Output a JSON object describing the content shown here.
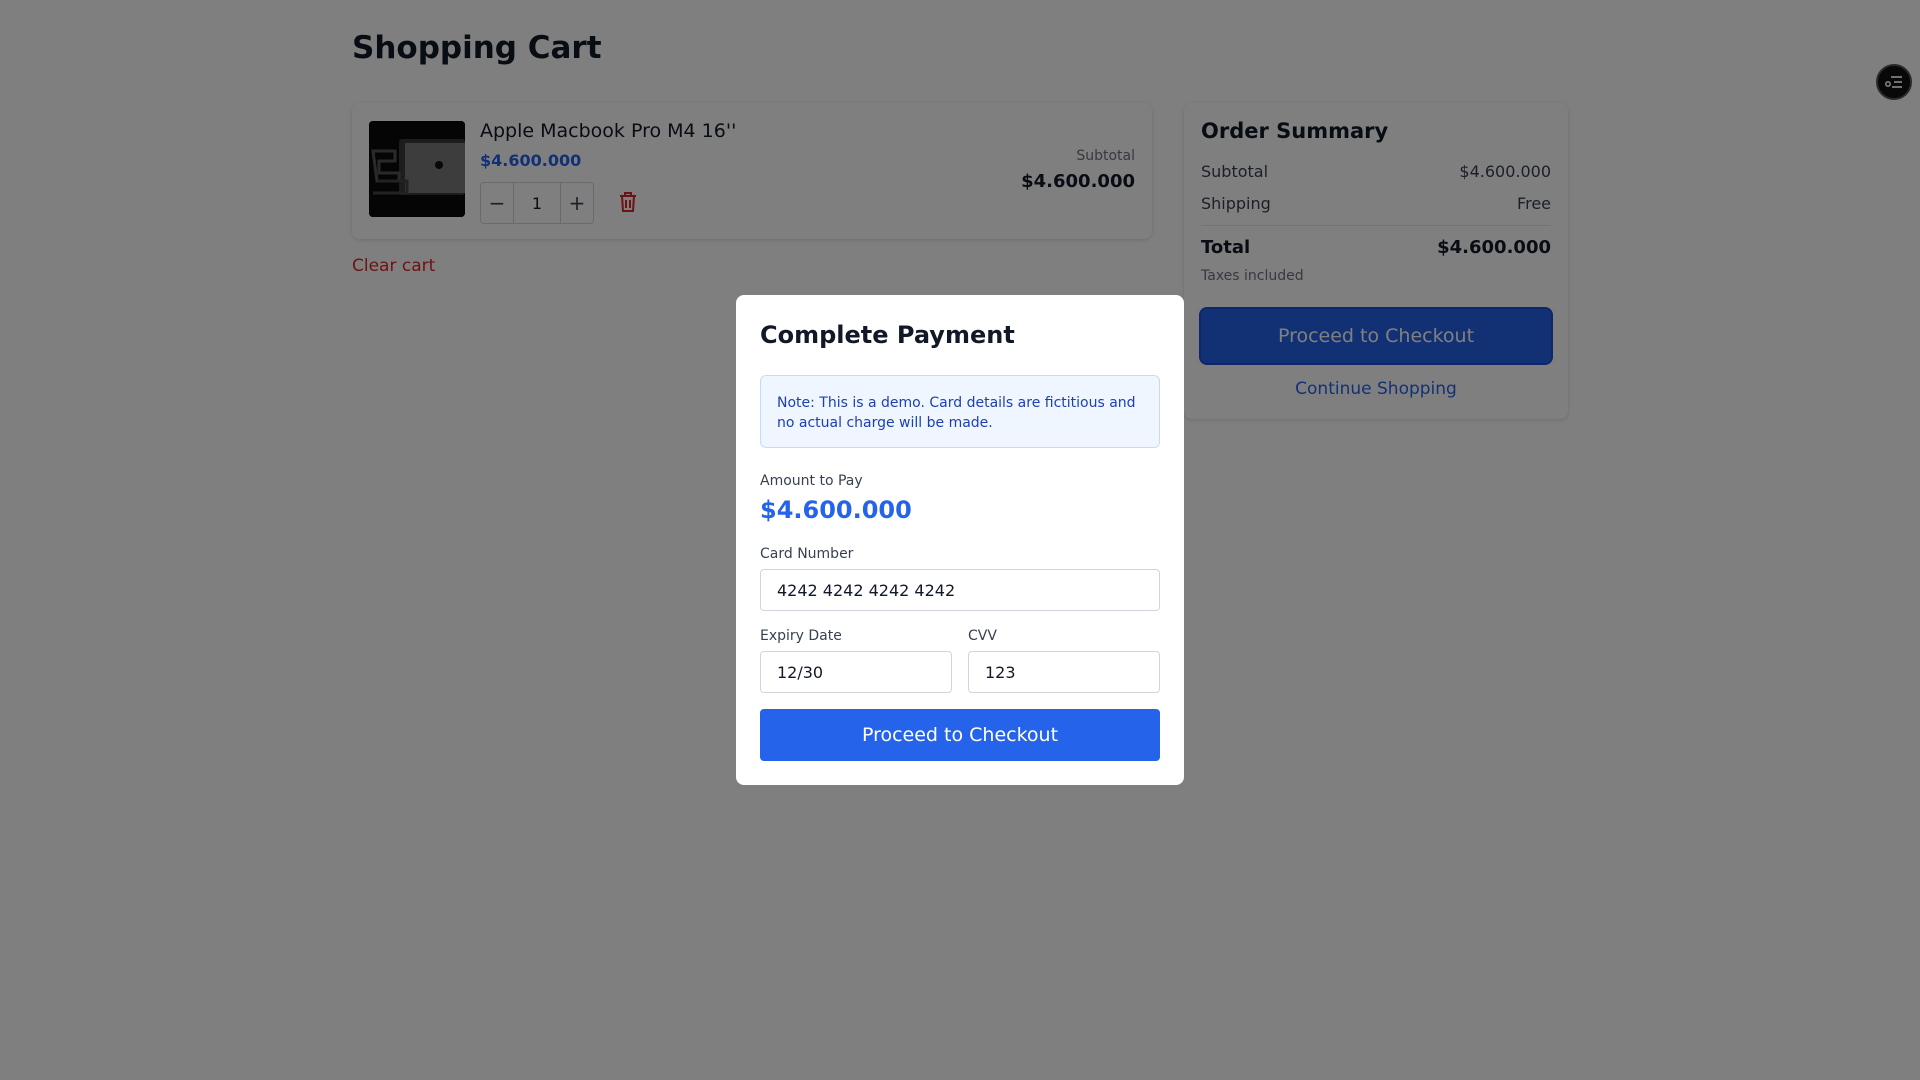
{
  "page": {
    "title": "Shopping Cart"
  },
  "cart": {
    "items": [
      {
        "name": "Apple Macbook Pro M4 16''",
        "price": "$4.600.000",
        "quantity": "1",
        "subtotal_label": "Subtotal",
        "subtotal": "$4.600.000"
      }
    ],
    "clear_label": "Clear cart"
  },
  "summary": {
    "title": "Order Summary",
    "subtotal_label": "Subtotal",
    "subtotal": "$4.600.000",
    "shipping_label": "Shipping",
    "shipping": "Free",
    "total_label": "Total",
    "total": "$4.600.000",
    "taxes_note": "Taxes included",
    "checkout_label": "Proceed to Checkout",
    "continue_label": "Continue Shopping"
  },
  "icons": {
    "minus": "minus-icon",
    "plus": "plus-icon",
    "trash": "trash-icon",
    "settings": "settings-icon"
  },
  "colors": {
    "accent": "#2563eb",
    "danger": "#dc2626",
    "note_bg": "#eff6ff"
  },
  "modal": {
    "title": "Complete Payment",
    "note": "Note: This is a demo. Card details are fictitious and no actual charge will be made.",
    "amount_label": "Amount to Pay",
    "amount": "$4.600.000",
    "card_number_label": "Card Number",
    "card_number": "4242 4242 4242 4242",
    "expiry_label": "Expiry Date",
    "expiry": "12/30",
    "cvv_label": "CVV",
    "cvv": "123",
    "submit_label": "Proceed to Checkout"
  }
}
